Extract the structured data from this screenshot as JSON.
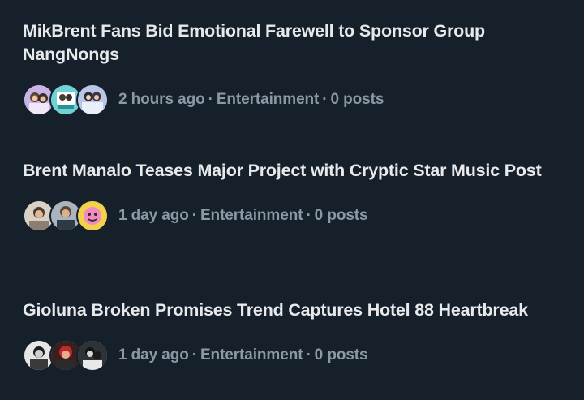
{
  "stories": [
    {
      "title": "MikBrent Fans Bid Emotional Farewell to Sponsor Group NangNongs",
      "time": "2 hours ago",
      "category": "Entertainment",
      "posts": "0 posts",
      "separator": "·"
    },
    {
      "title": "Brent Manalo Teases Major Project with Cryptic Star Music Post",
      "time": "1 day ago",
      "category": "Entertainment",
      "posts": "0 posts",
      "separator": "·"
    },
    {
      "title": "Gioluna Broken Promises Trend Captures Hotel 88 Heartbreak",
      "time": "1 day ago",
      "category": "Entertainment",
      "posts": "0 posts",
      "separator": "·"
    }
  ],
  "colors": {
    "background": "#15202b",
    "title": "#e7e9ea",
    "meta": "#8b98a5"
  }
}
